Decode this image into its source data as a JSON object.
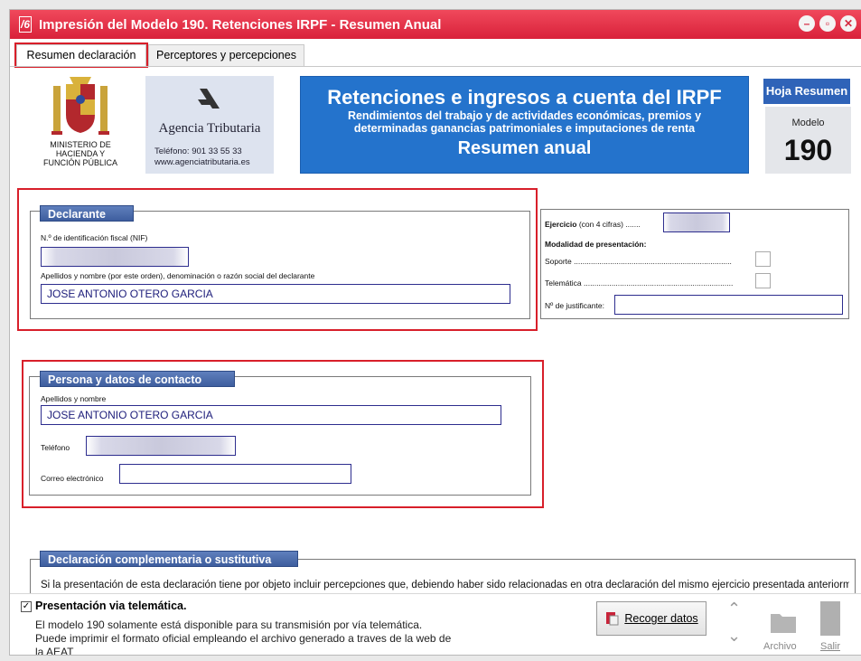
{
  "window": {
    "title": "Impresión del Modelo 190. Retenciones IRPF - Resumen Anual",
    "app_icon": "/6"
  },
  "tabs": [
    {
      "label": "Resumen declaración"
    },
    {
      "label": "Perceptores y percepciones"
    }
  ],
  "header": {
    "ministry": [
      "MINISTERIO DE",
      "HACIENDA Y",
      "FUNCIÓN PÚBLICA"
    ],
    "agency": {
      "name": "Agencia Tributaria",
      "phone": "Teléfono: 901 33 55 33",
      "web": "www.agenciatributaria.es"
    },
    "banner": {
      "title": "Retenciones e ingresos a cuenta del IRPF",
      "line1": "Rendimientos del trabajo y de actividades económicas, premios y",
      "line2": "determinadas ganancias patrimoniales e imputaciones de renta",
      "subtitle": "Resumen anual"
    },
    "hoja": "Hoja Resumen",
    "modelo_label": "Modelo",
    "modelo_num": "190"
  },
  "declarante": {
    "title": "Declarante",
    "nif_label": "N.º de identificación fiscal (NIF)",
    "nif_value": "",
    "name_label": "Apellidos y nombre (por este orden), denominación o razón social del declarante",
    "name_value": "JOSE ANTONIO OTERO GARCIA"
  },
  "ejercicio": {
    "ejercicio_label_bold": "Ejercicio",
    "ejercicio_label": "(con 4 cifras) .......",
    "ejercicio_value": "",
    "modalidad_label": "Modalidad de presentación:",
    "soporte_label": "Soporte ..........................................................................",
    "telematica_label": "Telemática ......................................................................",
    "justificante_label": "Nº de justificante:",
    "justificante_value": ""
  },
  "contacto": {
    "title": "Persona y datos de contacto",
    "name_label": "Apellidos y nombre",
    "name_value": "JOSE ANTONIO OTERO GARCIA",
    "phone_label": "Teléfono",
    "phone_value": "",
    "email_label": "Correo electrónico",
    "email_value": ""
  },
  "complementaria": {
    "title": "Declaración complementaria o sustitutiva",
    "text": "Si la presentación de esta declaración tiene por objeto incluir percepciones que, debiendo haber sido relacionadas en otra declaración del mismo ejercicio presentada anteriormente"
  },
  "bottom": {
    "checkbox_label": "Presentación via telemática.",
    "checkbox_checked": "✓",
    "msg1": "El modelo 190 solamente está disponible para su transmisión por vía telemática.",
    "msg2": "Puede imprimir el formato oficial empleando el archivo generado a traves de la web de",
    "msg3": "la AEAT",
    "recoger_label": "Recoger datos",
    "archivo_label": "Archivo",
    "salir_label": "Salir",
    "nav_up": "⌃",
    "nav_down": "⌄"
  },
  "colors": {
    "title_bar": "#e23048",
    "banner": "#2473cc",
    "section_title": "#4a6aab",
    "highlight": "#d81f2a"
  }
}
